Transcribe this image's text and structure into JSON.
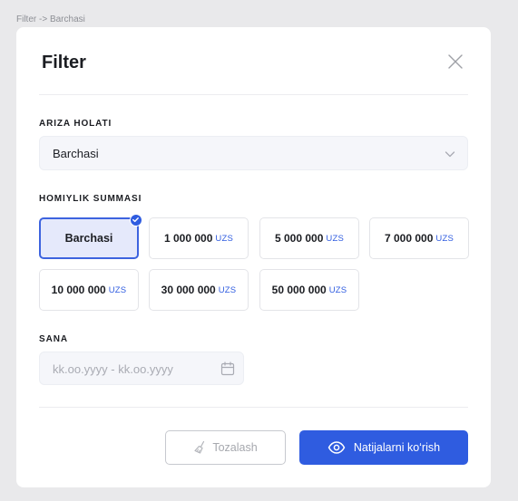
{
  "frame": {
    "breadcrumb": "Filter -> Barchasi"
  },
  "modal": {
    "title": "Filter",
    "status_section": {
      "label": "ARIZA HOLATI",
      "selected_value": "Barchasi"
    },
    "amount_section": {
      "label": "HOMIYLIK SUMMASI",
      "options": [
        {
          "value": "Barchasi",
          "currency": "",
          "selected": true
        },
        {
          "value": "1 000 000",
          "currency": "UZS",
          "selected": false
        },
        {
          "value": "5 000 000",
          "currency": "UZS",
          "selected": false
        },
        {
          "value": "7 000 000",
          "currency": "UZS",
          "selected": false
        },
        {
          "value": "10 000 000",
          "currency": "UZS",
          "selected": false
        },
        {
          "value": "30 000 000",
          "currency": "UZS",
          "selected": false
        },
        {
          "value": "50 000 000",
          "currency": "UZS",
          "selected": false
        }
      ]
    },
    "date_section": {
      "label": "SANA",
      "placeholder": "kk.oo.yyyy - kk.oo.yyyy"
    },
    "actions": {
      "clear_label": "Tozalash",
      "submit_label": "Natijalarni ko‘rish"
    }
  },
  "colors": {
    "accent": "#2F5CE0",
    "selected_bg": "#E5E9FB",
    "page_bg": "#E9E9EB"
  },
  "icons": [
    "close-icon",
    "chevron-down-icon",
    "check-icon",
    "calendar-icon",
    "broom-icon",
    "eye-icon"
  ]
}
